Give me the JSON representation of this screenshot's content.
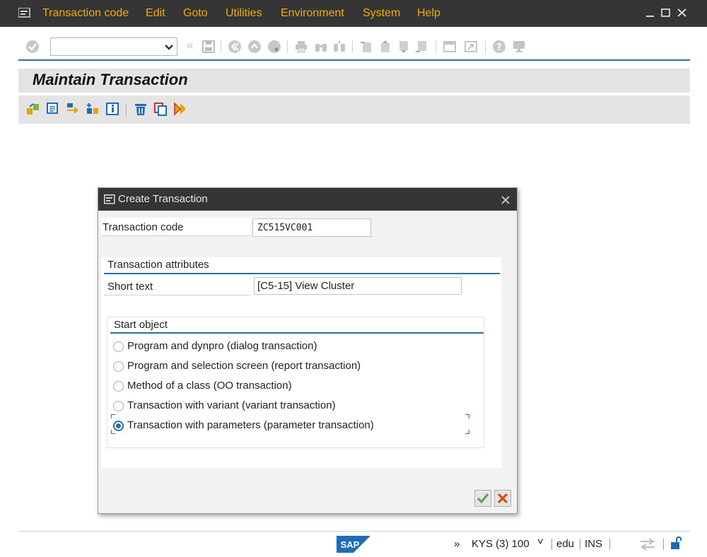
{
  "menubar": {
    "items": [
      "Transaction code",
      "Edit",
      "Goto",
      "Utilities",
      "Environment",
      "System",
      "Help"
    ],
    "icons": [
      "menu-icon",
      "minimize-icon",
      "maximize-icon",
      "close-icon"
    ]
  },
  "toolbar": {
    "command_field_value": "",
    "icons": [
      "enter-check-icon",
      "dropdown-icon",
      "save-icon",
      "back-icon",
      "exit-icon",
      "cancel-icon",
      "print-icon",
      "find-icon",
      "find-next-icon",
      "first-page-icon",
      "previous-page-icon",
      "next-page-icon",
      "last-page-icon",
      "new-session-icon",
      "shortcut-icon",
      "help-icon",
      "customize-layout-icon"
    ]
  },
  "title": "Maintain Transaction",
  "app_toolbar": {
    "icons": [
      "other-object-icon",
      "display-icon",
      "change-icon",
      "create-icon",
      "info-icon",
      "delete-icon",
      "copy-icon",
      "test-icon"
    ]
  },
  "dialog": {
    "title": "Create Transaction",
    "transaction_code_label": "Transaction code",
    "transaction_code_value": "ZC515VC001",
    "attributes_title": "Transaction attributes",
    "short_text_label": "Short text",
    "short_text_value": "[C5-15] View Cluster",
    "start_object_title": "Start object",
    "start_object_options": [
      {
        "label": "Program and dynpro (dialog transaction)",
        "selected": false
      },
      {
        "label": "Program and selection screen (report transaction)",
        "selected": false
      },
      {
        "label": "Method of a class (OO transaction)",
        "selected": false
      },
      {
        "label": "Transaction with variant (variant transaction)",
        "selected": false
      },
      {
        "label": "Transaction with parameters (parameter transaction)",
        "selected": true
      }
    ],
    "buttons": [
      "continue-check-icon",
      "cancel-x-icon"
    ]
  },
  "statusbar": {
    "logo": "SAP",
    "expand": "»",
    "system": "KYS (3) 100",
    "dropdown": "˅",
    "host": "edu",
    "mode": "INS"
  },
  "colors": {
    "menubar_bg": "#353535",
    "menu_text": "#f0ab00",
    "accent_blue": "#2c6fa2",
    "sap_blue": "#1d6cb5"
  }
}
